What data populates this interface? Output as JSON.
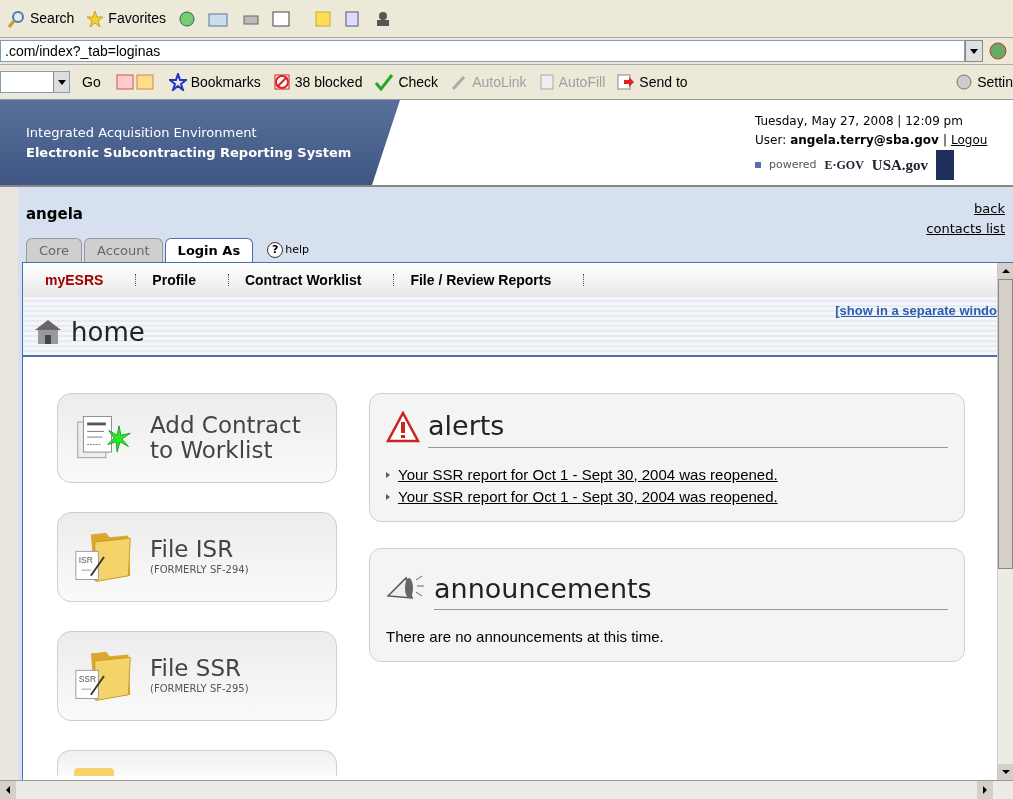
{
  "browser_toolbar": {
    "items": [
      {
        "kind": "search",
        "label": "Search"
      },
      {
        "kind": "favorites",
        "label": "Favorites"
      }
    ]
  },
  "address_bar": {
    "value": ".com/index?_tab=loginas"
  },
  "links_bar": {
    "go": "Go",
    "items": [
      {
        "kind": "bookmarks",
        "label": "Bookmarks",
        "disabled": false
      },
      {
        "kind": "blocked",
        "label": "38 blocked",
        "disabled": false
      },
      {
        "kind": "check",
        "label": "Check",
        "disabled": false
      },
      {
        "kind": "autolink",
        "label": "AutoLink",
        "disabled": true
      },
      {
        "kind": "autofill",
        "label": "AutoFill",
        "disabled": true
      },
      {
        "kind": "sendto",
        "label": "Send to",
        "disabled": false
      },
      {
        "kind": "settings",
        "label": "Settin",
        "disabled": false
      }
    ]
  },
  "header": {
    "line1": "Integrated Acquisition Environment",
    "line2": "Electronic Subcontracting Reporting System",
    "date": "Tuesday, May 27, 2008 | 12:09 pm",
    "user_label": "User:",
    "user_email": "angela.terry@sba.gov",
    "separator": "|",
    "logout": "Logou",
    "powered": "powered",
    "egov": "E·GOV",
    "usagov": "USA.gov"
  },
  "user_strip": {
    "name": "angela",
    "links": [
      "back",
      "contacts list"
    ]
  },
  "tabs": [
    {
      "label": "Core",
      "selected": false
    },
    {
      "label": "Account",
      "selected": false
    },
    {
      "label": "Login As",
      "selected": true
    }
  ],
  "help": {
    "icon": "?",
    "label": "help"
  },
  "nav": [
    {
      "label": "myESRS",
      "selected": true
    },
    {
      "label": "Profile",
      "selected": false
    },
    {
      "label": "Contract Worklist",
      "selected": false
    },
    {
      "label": "File / Review Reports",
      "selected": false
    }
  ],
  "page_title": "home",
  "separate_window": "[show in a separate windo",
  "actions": [
    {
      "kind": "add",
      "title": "Add Contract to Worklist"
    },
    {
      "kind": "isr",
      "title": "File ISR",
      "subtitle": "(FORMERLY SF-294)",
      "badge": "ISR"
    },
    {
      "kind": "ssr",
      "title": "File SSR",
      "subtitle": "(FORMERLY SF-295)",
      "badge": "SSR"
    },
    {
      "kind": "partial"
    }
  ],
  "alerts": {
    "title": "alerts",
    "items": [
      "Your SSR report for Oct 1 - Sept 30, 2004 was reopened.",
      "Your SSR report for Oct 1 - Sept 30, 2004 was reopened."
    ]
  },
  "announcements": {
    "title": "announcements",
    "text": "There are no announcements at this time."
  }
}
